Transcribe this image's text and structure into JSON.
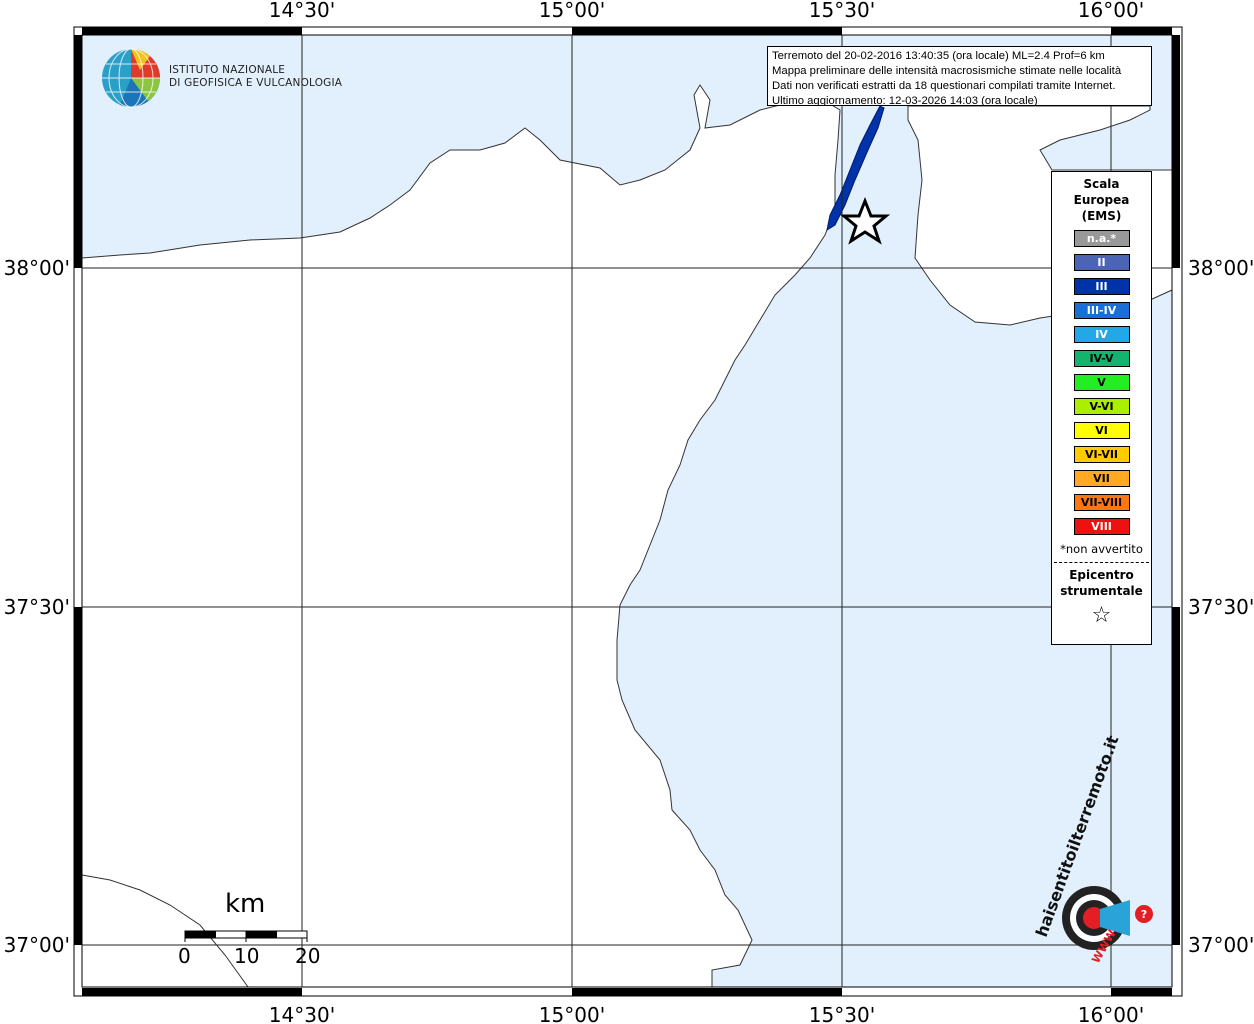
{
  "institute": {
    "line1": "ISTITUTO NAZIONALE",
    "line2": "DI GEOFISICA E VULCANOLOGIA"
  },
  "info": {
    "line1": "Terremoto del 20-02-2016 13:40:35 (ora locale) ML=2.4 Prof=6 km",
    "line2": "Mappa preliminare delle intensità macrosismiche stimate nelle località",
    "line3": "Dati non verificati estratti da 18 questionari compilati tramite Internet.",
    "line4": "Ultimo aggiornamento: 12-03-2026 14:03 (ora locale)"
  },
  "axes": {
    "lon_labels": [
      "14°30'",
      "15°00'",
      "15°30'",
      "16°00'"
    ],
    "lat_labels": [
      "38°00'",
      "37°30'",
      "37°00'"
    ]
  },
  "legend": {
    "title": [
      "Scala",
      "Europea",
      "(EMS)"
    ],
    "items": [
      {
        "label": "n.a.*",
        "color": "#999999",
        "text_color": "#ffffff"
      },
      {
        "label": "II",
        "color": "#4b64b4",
        "text_color": "#ffffff"
      },
      {
        "label": "III",
        "color": "#0033aa",
        "text_color": "#ffffff"
      },
      {
        "label": "III-IV",
        "color": "#1a6ed6",
        "text_color": "#ffffff"
      },
      {
        "label": "IV",
        "color": "#22a8e6",
        "text_color": "#ffffff"
      },
      {
        "label": "IV-V",
        "color": "#14b46e",
        "text_color": "#000000"
      },
      {
        "label": "V",
        "color": "#22ee22",
        "text_color": "#000000"
      },
      {
        "label": "V-VI",
        "color": "#aaee00",
        "text_color": "#000000"
      },
      {
        "label": "VI",
        "color": "#ffff00",
        "text_color": "#000000"
      },
      {
        "label": "VI-VII",
        "color": "#ffcc00",
        "text_color": "#000000"
      },
      {
        "label": "VII",
        "color": "#ffaa22",
        "text_color": "#000000"
      },
      {
        "label": "VII-VIII",
        "color": "#ff7711",
        "text_color": "#000000"
      },
      {
        "label": "VIII",
        "color": "#ee1111",
        "text_color": "#ffffff"
      }
    ],
    "note": "*non avvertito",
    "epicenter_label": [
      "Epicentro",
      "strumentale"
    ],
    "star": "☆"
  },
  "scale_bar": {
    "unit": "km",
    "ticks": [
      "0",
      "10",
      "20"
    ]
  },
  "badge": {
    "text_top": "haisentitoilterremoto.it",
    "text_www": "WWW"
  },
  "colors": {
    "sea": "#e1f0fc",
    "land": "#ffffff",
    "intensity_III": "#0033aa"
  }
}
